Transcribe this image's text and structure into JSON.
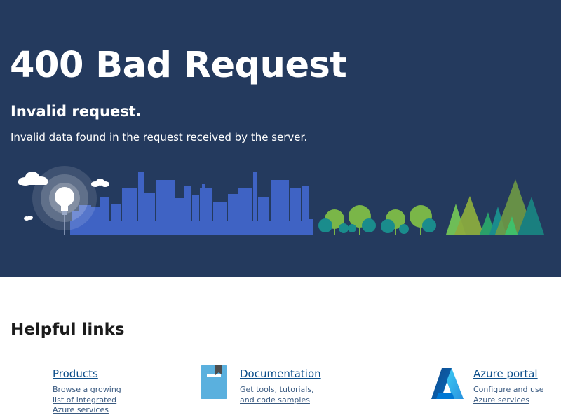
{
  "hero": {
    "title": "400 Bad Request",
    "subtitle": "Invalid request.",
    "message": "Invalid data found in the request received by the server."
  },
  "helpful_links": {
    "title": "Helpful links",
    "items": [
      {
        "icon": "products-icon",
        "title": "Products",
        "description_lines": [
          "Browse a growing",
          "list of integrated",
          "Azure services"
        ]
      },
      {
        "icon": "documentation-icon",
        "title": "Documentation",
        "description_lines": [
          "Get tools, tutorials,",
          "and code samples"
        ]
      },
      {
        "icon": "azure-logo-icon",
        "title": "Azure portal",
        "description_lines": [
          "Configure and use",
          "Azure services"
        ]
      }
    ]
  },
  "colors": {
    "hero_background": "#243a5e",
    "link": "#0d4f8b",
    "city": "#3f63c4",
    "tree_green": "#7ab648",
    "tree_teal": "#1a8c8c"
  }
}
